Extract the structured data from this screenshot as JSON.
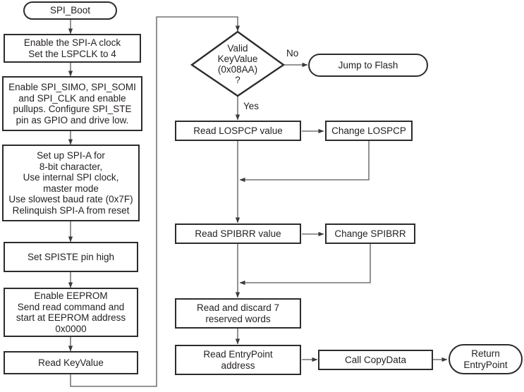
{
  "diagram": {
    "title": "SPI_Boot flowchart",
    "style": {
      "stroke": "#2c2c2c",
      "thin_stroke": "#58585a",
      "text": "#231f20",
      "background": "#ffffff"
    },
    "nodes": {
      "spi_boot": {
        "label": "SPI_Boot",
        "shape": "terminator"
      },
      "enable_clock": {
        "label": "Enable the SPI-A clock\nSet the LSPCLK to 4",
        "shape": "process"
      },
      "enable_pins": {
        "label": "Enable SPI_SIMO, SPI_SOMI\nand SPI_CLK and enable\npullups. Configure SPI_STE\npin as GPIO and drive low.",
        "shape": "process"
      },
      "setup_spia": {
        "label": "Set up SPI-A for\n8-bit character,\nUse internal SPI clock,\nmaster mode\nUse slowest baud rate (0x7F)\nRelinquish SPI-A from reset",
        "shape": "process"
      },
      "set_spiste": {
        "label": "Set SPISTE pin high",
        "shape": "process"
      },
      "enable_eeprom": {
        "label": "Enable EEPROM\nSend read command and\nstart at EEPROM address\n0x0000",
        "shape": "process"
      },
      "read_keyvalue": {
        "label": "Read KeyValue",
        "shape": "process"
      },
      "valid_keyvalue": {
        "label": "Valid\nKeyValue\n(0x08AA)\n?",
        "shape": "decision"
      },
      "jump_to_flash": {
        "label": "Jump to Flash",
        "shape": "terminator"
      },
      "read_lospcp": {
        "label": "Read LOSPCP value",
        "shape": "process"
      },
      "change_lospcp": {
        "label": "Change LOSPCP",
        "shape": "process"
      },
      "read_spibrr": {
        "label": "Read SPIBRR value",
        "shape": "process"
      },
      "change_spibrr": {
        "label": "Change SPIBRR",
        "shape": "process"
      },
      "read_discard": {
        "label": "Read and discard 7\nreserved words",
        "shape": "process"
      },
      "read_entrypoint": {
        "label": "Read EntryPoint\naddress",
        "shape": "process"
      },
      "call_copydata": {
        "label": "Call CopyData",
        "shape": "process"
      },
      "return_entrypoint": {
        "label": "Return\nEntryPoint",
        "shape": "terminator"
      }
    },
    "edge_labels": {
      "no": "No",
      "yes": "Yes"
    }
  }
}
